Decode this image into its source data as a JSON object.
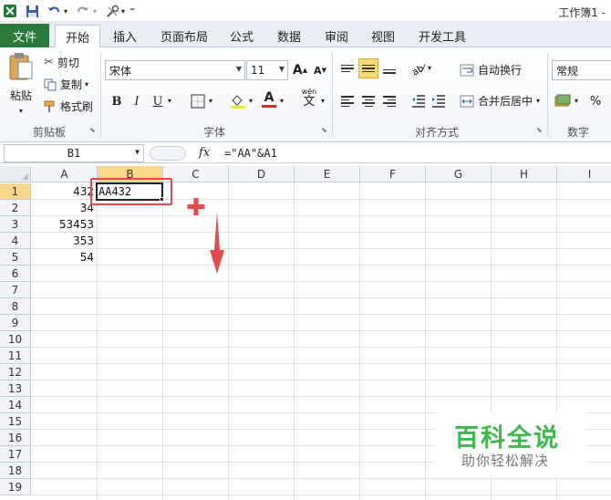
{
  "window": {
    "title": "工作簿1 -"
  },
  "quick_access": {
    "customize": "⁼"
  },
  "tabs": [
    {
      "label": "文件"
    },
    {
      "label": "开始"
    },
    {
      "label": "插入"
    },
    {
      "label": "页面布局"
    },
    {
      "label": "公式"
    },
    {
      "label": "数据"
    },
    {
      "label": "审阅"
    },
    {
      "label": "视图"
    },
    {
      "label": "开发工具"
    }
  ],
  "ribbon": {
    "clipboard": {
      "paste": "粘贴",
      "cut": "剪切",
      "copy": "复制",
      "format_painter": "格式刷",
      "group": "剪贴板"
    },
    "font": {
      "name": "宋体",
      "size": "11",
      "grow": "A",
      "shrink": "A",
      "bold": "B",
      "italic": "I",
      "underline": "U",
      "font_color_letter": "A",
      "phonetic": "wén",
      "phonetic_glyph": "文",
      "group": "字体"
    },
    "alignment": {
      "wrap": "自动换行",
      "merge": "合并后居中",
      "group": "对齐方式"
    },
    "number": {
      "format": "常规",
      "percent": "%",
      "group": "数字"
    }
  },
  "formula_bar": {
    "name_box": "B1",
    "fx": "fx",
    "formula": "=\"AA\"&A1"
  },
  "columns": [
    "A",
    "B",
    "C",
    "D",
    "E",
    "F",
    "G",
    "H",
    "I"
  ],
  "rows": [
    "1",
    "2",
    "3",
    "4",
    "5",
    "6",
    "7",
    "8",
    "9",
    "10",
    "11",
    "12",
    "13",
    "14",
    "15",
    "16",
    "17",
    "18",
    "19"
  ],
  "cells": {
    "A1": "432",
    "A2": "34",
    "A3": "53453",
    "A4": "353",
    "A5": "54",
    "B1": "AA432"
  },
  "annotations": {
    "plus": "✚"
  },
  "watermark": {
    "title": "百科全说",
    "subtitle": "助你轻松解决"
  },
  "colors": {
    "file_tab": "#2a7a3c",
    "annotation_red": "#e34a4a",
    "watermark_green": "#3fb84c",
    "selected_header": "#f9d78b"
  }
}
